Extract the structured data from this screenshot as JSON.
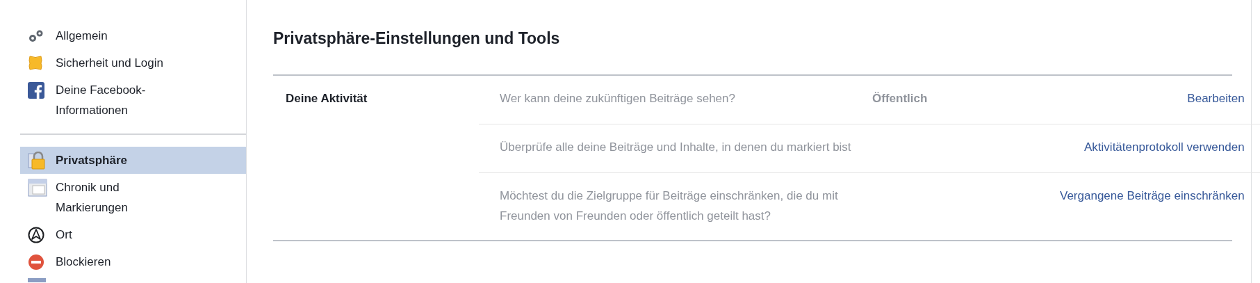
{
  "sidebar": {
    "groups": [
      {
        "items": [
          {
            "label": "Allgemein",
            "selected": false
          },
          {
            "label": "Sicherheit und Login",
            "selected": false
          },
          {
            "label": "Deine Facebook-\nInformationen",
            "selected": false
          }
        ]
      },
      {
        "items": [
          {
            "label": "Privatsphäre",
            "selected": true
          },
          {
            "label": "Chronik und\nMarkierungen",
            "selected": false
          },
          {
            "label": "Ort",
            "selected": false
          },
          {
            "label": "Blockieren",
            "selected": false
          }
        ]
      }
    ]
  },
  "main": {
    "title": "Privatsphäre-Einstellungen und Tools",
    "sections": [
      {
        "title": "Deine Aktivität",
        "rows": [
          {
            "question": "Wer kann deine zukünftigen Beiträge sehen?",
            "value": "Öffentlich",
            "action": "Bearbeiten"
          },
          {
            "question": "Überprüfe alle deine Beiträge und Inhalte, in denen du markiert bist",
            "action": "Aktivitätenprotokoll verwenden"
          },
          {
            "question": "Möchtest du die Zielgruppe für Beiträge einschränken, die du mit Freunden von Freunden oder öffentlich geteilt hast?",
            "action": "Vergangene Beiträge einschränken"
          }
        ]
      }
    ]
  }
}
